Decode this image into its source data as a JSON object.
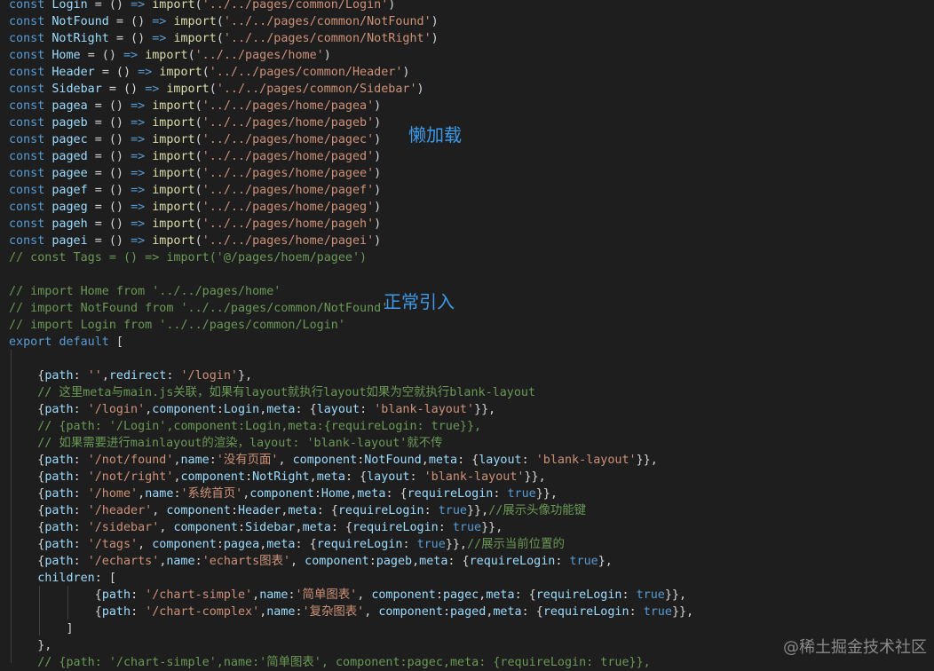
{
  "code_lines": [
    "const Login = () => import('../../pages/common/Login')",
    "const NotFound = () => import('../../pages/common/NotFound')",
    "const NotRight = () => import('../../pages/common/NotRight')",
    "const Home = () => import('../../pages/home')",
    "const Header = () => import('../../pages/common/Header')",
    "const Sidebar = () => import('../../pages/common/Sidebar')",
    "const pagea = () => import('../../pages/home/pagea')",
    "const pageb = () => import('../../pages/home/pageb')",
    "const pagec = () => import('../../pages/home/pagec')",
    "const paged = () => import('../../pages/home/paged')",
    "const pagee = () => import('../../pages/home/pagee')",
    "const pagef = () => import('../../pages/home/pagef')",
    "const pageg = () => import('../../pages/home/pageg')",
    "const pageh = () => import('../../pages/home/pageh')",
    "const pagei = () => import('../../pages/home/pagei')",
    "// const Tags = () => import('@/pages/hoem/pagee')",
    "",
    "// import Home from '../../pages/home'",
    "// import NotFound from '../../pages/common/NotFound'",
    "// import Login from '../../pages/common/Login'",
    "export default [",
    "",
    "    {path: '',redirect: '/login'},",
    "    // 这里meta与main.js关联，如果有layout就执行layout如果为空就执行blank-layout",
    "    {path: '/login',component:Login,meta: {layout: 'blank-layout'}},",
    "    // {path: '/Login',component:Login,meta:{requireLogin: true}},",
    "    // 如果需要进行mainlayout的渲染，layout: 'blank-layout'就不传",
    "    {path: '/not/found',name:'没有页面', component:NotFound,meta: {layout: 'blank-layout'}},",
    "    {path: '/not/right',component:NotRight,meta: {layout: 'blank-layout'}},",
    "    {path: '/home',name:'系统首页',component:Home,meta: {requireLogin: true}},",
    "    {path: '/header', component:Header,meta: {requireLogin: true}},//展示头像功能键",
    "    {path: '/sidebar', component:Sidebar,meta: {requireLogin: true}},",
    "    {path: '/tags', component:pagea,meta: {requireLogin: true}},//展示当前位置的",
    "    {path: '/echarts',name:'echarts图表', component:pageb,meta: {requireLogin: true},",
    "    children: [",
    "            {path: '/chart-simple',name:'简单图表', component:pagec,meta: {requireLogin: true}},",
    "            {path: '/chart-complex',name:'复杂图表', component:paged,meta: {requireLogin: true}},",
    "        ]",
    "    },",
    "    // {path: '/chart-simple',name:'简单图表', component:pagec,meta: {requireLogin: true}},"
  ],
  "annotations": {
    "lazy_load": "懒加载",
    "normal_import": "正常引入"
  },
  "watermark": "@稀土掘金技术社区",
  "colors": {
    "background": "#1e1e1e",
    "keyword": "#569cd6",
    "identifier": "#9cdcfe",
    "function": "#dcdcaa",
    "string": "#ce9178",
    "comment": "#6a9955",
    "annotation": "#3d9ae8"
  }
}
